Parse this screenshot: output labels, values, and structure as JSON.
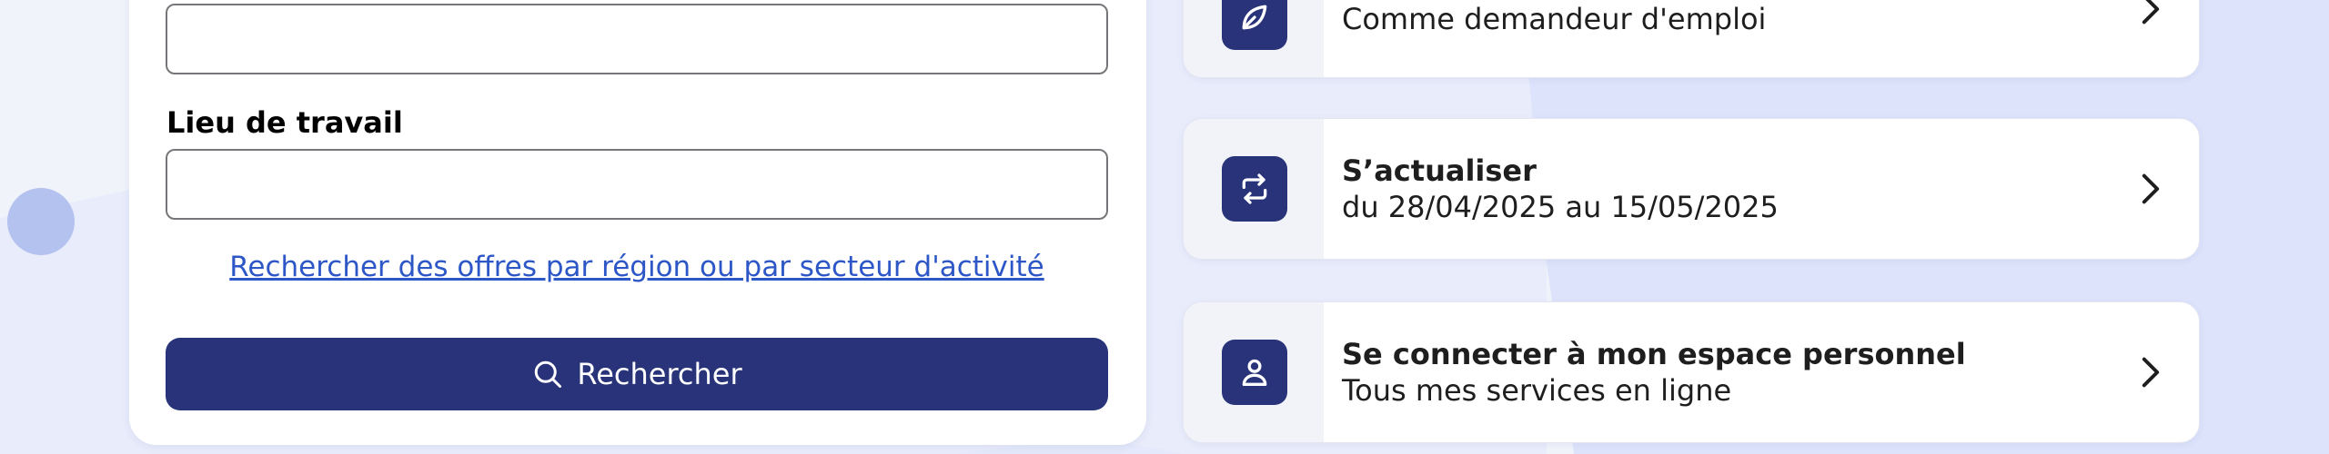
{
  "search_form": {
    "field1": {
      "value": "",
      "placeholder": ""
    },
    "location": {
      "label": "Lieu de travail",
      "value": "",
      "placeholder": ""
    },
    "region_link": "Rechercher des offres par région ou par secteur d'activité",
    "search_button": "Rechercher"
  },
  "tiles": [
    {
      "title": "",
      "subtitle": "Comme demandeur d'emploi",
      "icon": "leaf-icon"
    },
    {
      "title": "S’actualiser",
      "subtitle": "du 28/04/2025 au 15/05/2025",
      "icon": "refresh-icon"
    },
    {
      "title": "Se connecter à mon espace personnel",
      "subtitle": "Tous mes services en ligne",
      "icon": "user-icon"
    }
  ],
  "colors": {
    "primary": "#28337a",
    "link": "#2d57c7",
    "background": "#f1f3fb",
    "background_shape": "#dde3fb",
    "decor_dot": "#b4c2ef"
  }
}
